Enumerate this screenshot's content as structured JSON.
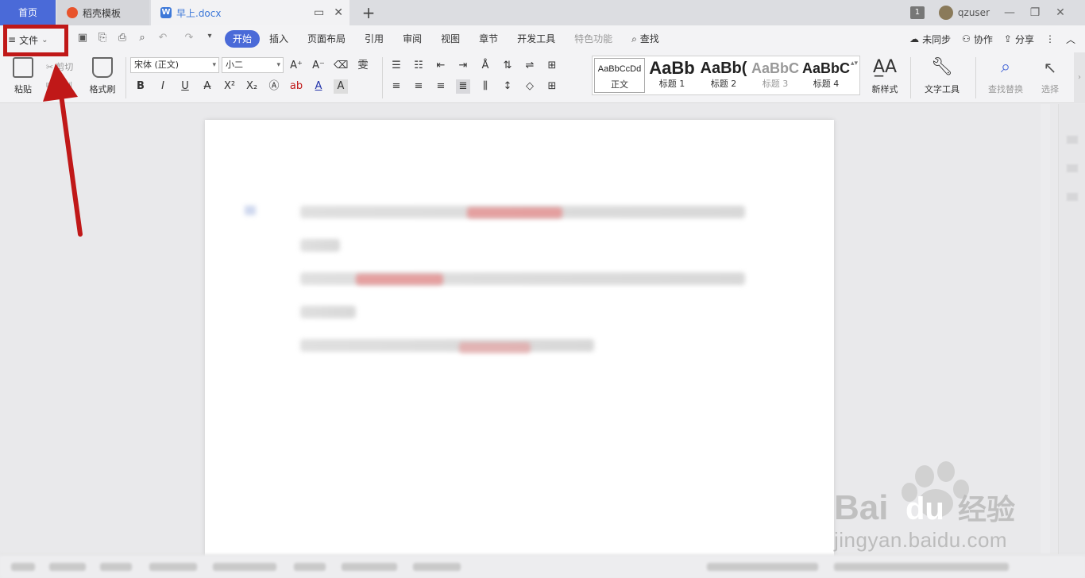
{
  "tabs": {
    "home": "首页",
    "templates": "稻壳模板",
    "document": "早上.docx",
    "new_tab": "+"
  },
  "window": {
    "badge": "1",
    "user": "qzuser",
    "minimize": "—",
    "restore": "❐",
    "close": "✕"
  },
  "file_menu": {
    "label": "文件"
  },
  "menu_tabs": [
    "开始",
    "插入",
    "页面布局",
    "引用",
    "审阅",
    "视图",
    "章节",
    "开发工具",
    "特色功能",
    "查找"
  ],
  "menu_right": {
    "sync": "未同步",
    "collab": "协作",
    "share": "分享"
  },
  "ribbon": {
    "paste": "粘贴",
    "cut": "剪切",
    "copy": "复制",
    "format_painter": "格式刷",
    "font_name": "宋体 (正文)",
    "font_size": "小二",
    "styles": [
      {
        "preview": "AaBbCcDd",
        "name": "正文"
      },
      {
        "preview": "AaBb",
        "name": "标题 1"
      },
      {
        "preview": "AaBb(",
        "name": "标题 2"
      },
      {
        "preview": "AaBbC",
        "name": "标题 3"
      },
      {
        "preview": "AaBbC",
        "name": "标题 4"
      }
    ],
    "new_style": "新样式",
    "text_tools": "文字工具",
    "find_replace": "查找替换",
    "select": "选择"
  },
  "watermark": {
    "brand": "Bai",
    "brand2": "du",
    "cn": "经验",
    "url": "jingyan.baidu.com"
  },
  "colors": {
    "accent": "#4a6ad8",
    "highlight": "#c01818"
  }
}
